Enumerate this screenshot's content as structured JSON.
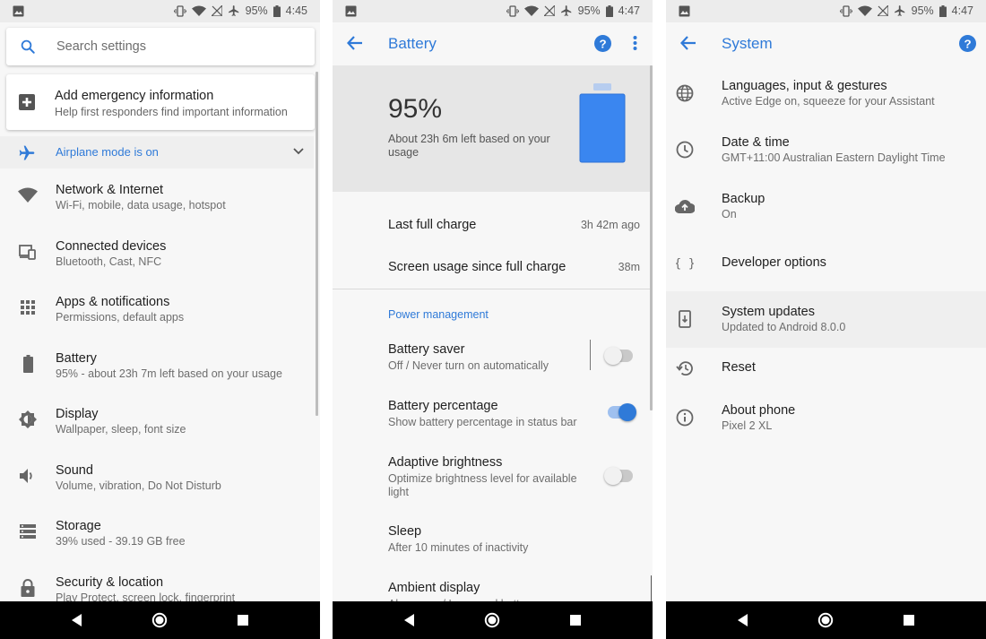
{
  "status_bar_1": {
    "battery": "95%",
    "time": "4:45"
  },
  "status_bar_2": {
    "battery": "95%",
    "time": "4:47"
  },
  "status_bar_3": {
    "battery": "95%",
    "time": "4:47"
  },
  "colors": {
    "accent": "#2f7ad8",
    "battery_fill": "#3a86f0"
  },
  "settings": {
    "search_placeholder": "Search settings",
    "emergency": {
      "title": "Add emergency information",
      "subtitle": "Help first responders find important information"
    },
    "airplane": "Airplane mode is on",
    "items": [
      {
        "title": "Network & Internet",
        "subtitle": "Wi-Fi, mobile, data usage, hotspot",
        "icon": "wifi-icon"
      },
      {
        "title": "Connected devices",
        "subtitle": "Bluetooth, Cast, NFC",
        "icon": "devices-icon"
      },
      {
        "title": "Apps & notifications",
        "subtitle": "Permissions, default apps",
        "icon": "apps-grid-icon"
      },
      {
        "title": "Battery",
        "subtitle": "95% - about 23h 7m left based on your usage",
        "icon": "battery-icon"
      },
      {
        "title": "Display",
        "subtitle": "Wallpaper, sleep, font size",
        "icon": "brightness-icon"
      },
      {
        "title": "Sound",
        "subtitle": "Volume, vibration, Do Not Disturb",
        "icon": "volume-icon"
      },
      {
        "title": "Storage",
        "subtitle": "39% used - 39.19 GB free",
        "icon": "storage-icon"
      },
      {
        "title": "Security & location",
        "subtitle": "Play Protect, screen lock, fingerprint",
        "icon": "lock-icon"
      }
    ]
  },
  "battery": {
    "title": "Battery",
    "percent": "95%",
    "time_left": "About 23h 6m left based on your usage",
    "level": 0.95,
    "last_full_charge": {
      "label": "Last full charge",
      "value": "3h 42m ago"
    },
    "screen_usage": {
      "label": "Screen usage since full charge",
      "value": "38m"
    },
    "section_title": "Power management",
    "items": [
      {
        "title": "Battery saver",
        "subtitle": "Off / Never turn on automatically",
        "toggle": false
      },
      {
        "title": "Battery percentage",
        "subtitle": "Show battery percentage in status bar",
        "toggle": true
      },
      {
        "title": "Adaptive brightness",
        "subtitle": "Optimize brightness level for available light",
        "toggle": false
      },
      {
        "title": "Sleep",
        "subtitle": "After 10 minutes of inactivity"
      },
      {
        "title": "Ambient display",
        "subtitle": "Always on / Increased battery usage"
      }
    ]
  },
  "system": {
    "title": "System",
    "items": [
      {
        "title": "Languages, input & gestures",
        "subtitle": "Active Edge on, squeeze for your Assistant",
        "icon": "globe-icon"
      },
      {
        "title": "Date & time",
        "subtitle": "GMT+11:00 Australian Eastern Daylight Time",
        "icon": "clock-icon"
      },
      {
        "title": "Backup",
        "subtitle": "On",
        "icon": "cloud-upload-icon"
      },
      {
        "title": "Developer options",
        "subtitle": "",
        "icon": "braces-icon"
      },
      {
        "title": "System updates",
        "subtitle": "Updated to Android 8.0.0",
        "icon": "system-update-icon"
      },
      {
        "title": "Reset",
        "subtitle": "",
        "icon": "restore-icon"
      },
      {
        "title": "About phone",
        "subtitle": "Pixel 2 XL",
        "icon": "info-icon"
      }
    ]
  }
}
